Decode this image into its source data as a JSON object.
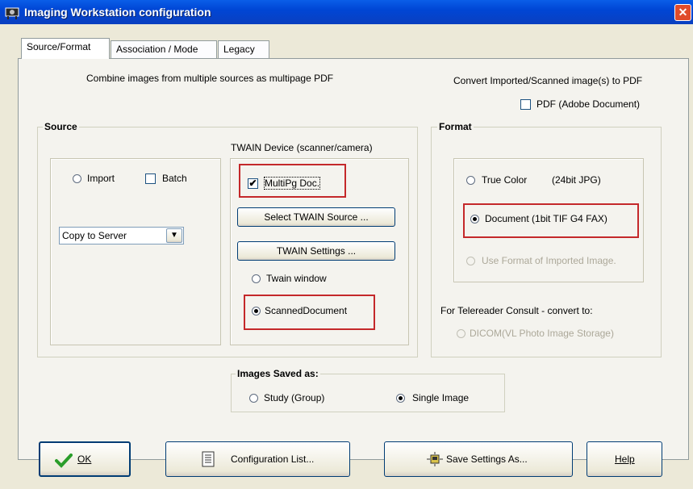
{
  "window": {
    "title": "Imaging Workstation configuration",
    "close_glyph": "✕"
  },
  "tabs": [
    {
      "label": "Source/Format",
      "active": true
    },
    {
      "label": "Association / Mode",
      "active": false
    },
    {
      "label": "Legacy",
      "active": false
    }
  ],
  "header": {
    "combine_text": "Combine images from multiple sources as multipage PDF",
    "convert_text": "Convert Imported/Scanned image(s) to PDF",
    "pdf_label": "PDF (Adobe Document)",
    "pdf_checked": false
  },
  "source": {
    "group_label": "Source",
    "import_label": "Import",
    "import_selected": false,
    "batch_label": "Batch",
    "batch_checked": false,
    "dropdown_value": "Copy to Server",
    "dropdown_arrow": "▼",
    "twain_heading": "TWAIN Device (scanner/camera)",
    "multipg_label": "MultiPg Doc.",
    "multipg_checked": true,
    "check_mark": "✔",
    "select_source_button": "Select TWAIN Source ...",
    "settings_button": "TWAIN Settings ...",
    "twain_window_label": "Twain window",
    "twain_window_selected": false,
    "scanned_document_label": "ScannedDocument",
    "scanned_document_selected": true
  },
  "format": {
    "group_label": "Format",
    "true_color_label": "True Color",
    "true_color_detail": "(24bit JPG)",
    "document_label": "Document (1bit TIF G4 FAX)",
    "document_selected": true,
    "use_imported_label": "Use Format of Imported Image.",
    "telereader_label": "For Telereader Consult - convert to:",
    "dicom_label": "DICOM(VL Photo Image Storage)"
  },
  "saved_as": {
    "group_label": "Images Saved as:",
    "study_label": "Study (Group)",
    "single_label": "Single Image",
    "selected": "Single Image"
  },
  "buttons": {
    "ok": "OK",
    "config_list": "Configuration List...",
    "save_settings": "Save Settings As...",
    "help": "Help"
  },
  "colors": {
    "highlight": "#c4282a",
    "titlebar": "#0046d5",
    "ok_check": "#2a9d2a"
  },
  "icons": {
    "title": "camera-icon",
    "ok": "checkmark-icon",
    "config_list": "list-document-icon",
    "save_settings": "save-settings-icon"
  }
}
